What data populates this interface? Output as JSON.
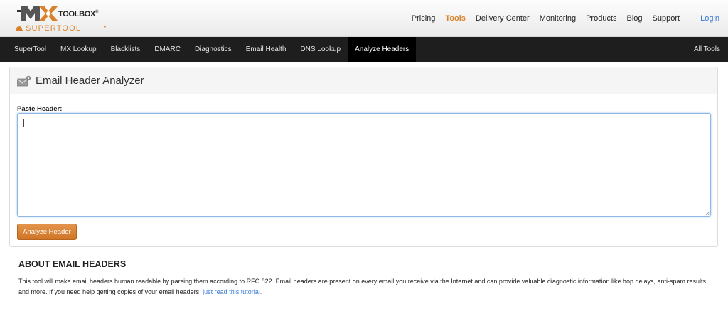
{
  "brand": {
    "logo_text": "TOOLBOX",
    "logo_mark": "MX",
    "registered": "®",
    "subtitle": "SUPERTOOL"
  },
  "topnav": {
    "items": [
      {
        "label": "Pricing"
      },
      {
        "label": "Tools",
        "active": true
      },
      {
        "label": "Delivery Center"
      },
      {
        "label": "Monitoring"
      },
      {
        "label": "Products"
      },
      {
        "label": "Blog"
      },
      {
        "label": "Support"
      }
    ],
    "login": "Login"
  },
  "darknav": {
    "items": [
      {
        "label": "SuperTool"
      },
      {
        "label": "MX Lookup"
      },
      {
        "label": "Blacklists"
      },
      {
        "label": "DMARC"
      },
      {
        "label": "Diagnostics"
      },
      {
        "label": "Email Health"
      },
      {
        "label": "DNS Lookup"
      },
      {
        "label": "Analyze Headers",
        "active": true
      }
    ],
    "all_tools": "All Tools"
  },
  "panel": {
    "icon": "envelope-gear-icon",
    "title": "Email Header Analyzer",
    "paste_label": "Paste Header:",
    "input_value": "",
    "button_label": "Analyze Header"
  },
  "about": {
    "title": "ABOUT EMAIL HEADERS",
    "text": "This tool will make email headers human readable by parsing them according to RFC 822.  Email headers are present on every email you receive via the Internet and can provide valuable diagnostic information like hop delays, anti-spam results and more. If you need help getting copies of your email headers, ",
    "link": "just read this tutorial."
  },
  "colors": {
    "accent": "#d9822b",
    "dark_nav": "#1e1e1e",
    "link": "#3a7bd5"
  }
}
